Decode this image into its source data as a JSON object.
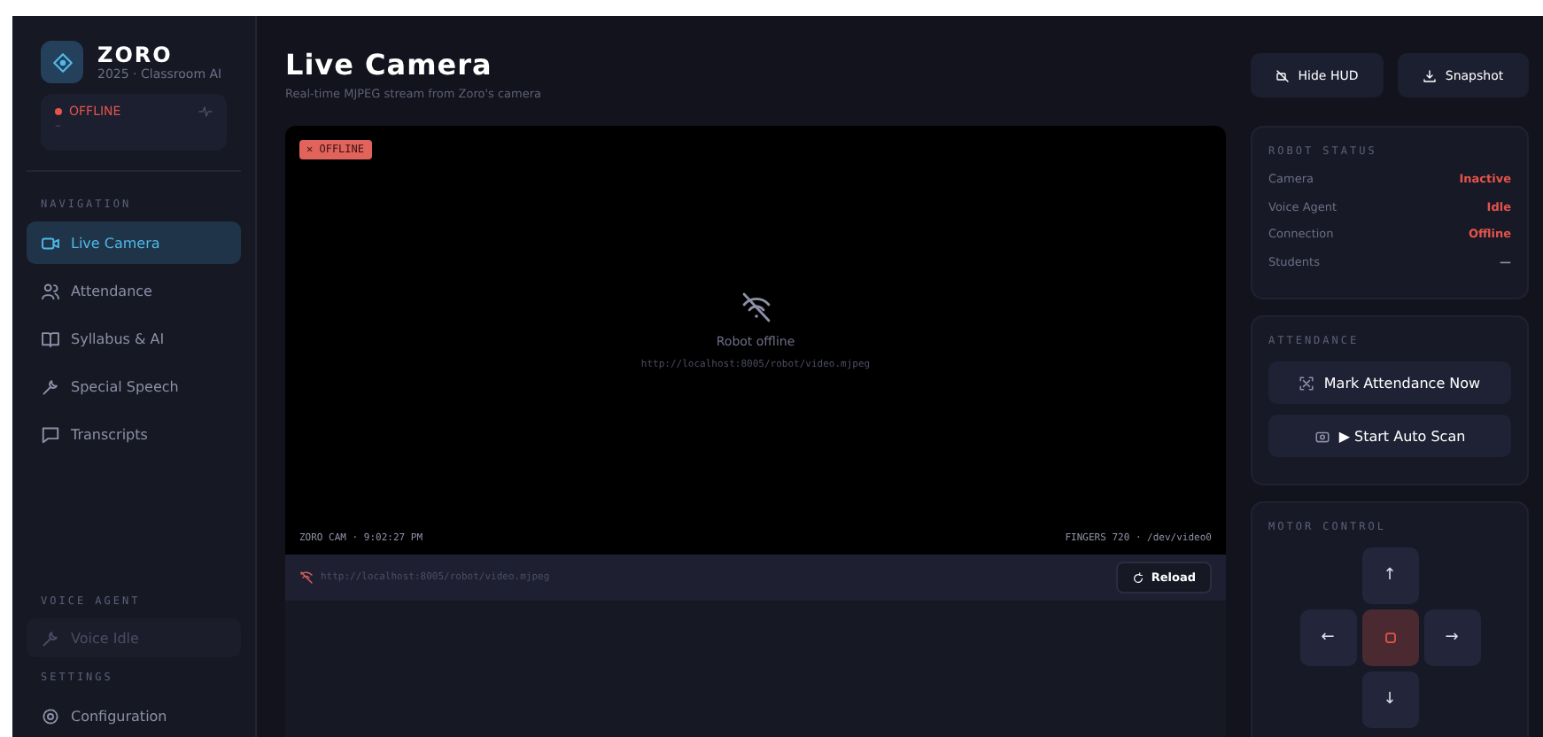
{
  "brand": {
    "name": "ZORO",
    "subtitle": "2025 · Classroom AI"
  },
  "connection": {
    "label": "OFFLINE",
    "detail": "–",
    "online": false
  },
  "sidebar": {
    "nav_heading": "NAVIGATION",
    "items": [
      {
        "label": "Live Camera",
        "selected": true
      },
      {
        "label": "Attendance",
        "selected": false
      },
      {
        "label": "Syllabus & AI",
        "selected": false
      },
      {
        "label": "Special Speech",
        "selected": false
      },
      {
        "label": "Transcripts",
        "selected": false
      }
    ],
    "voice_heading": "VOICE AGENT",
    "voice_status": "Voice Idle",
    "voice_active": false,
    "settings_heading": "SETTINGS",
    "settings_item": "Configuration"
  },
  "header": {
    "title": "Live Camera",
    "subtitle": "Real-time MJPEG stream from Zoro's camera"
  },
  "toolbar": {
    "buttons": [
      "Hide HUD",
      "Snapshot"
    ]
  },
  "camera": {
    "badge": "✕ OFFLINE",
    "online": false,
    "message": "Robot offline",
    "stream_url": "http://localhost:8005/robot/video.mjpeg",
    "hud_left": "ZORO CAM · 9:02:27 PM",
    "hud_right": "FINGERS 720 · /dev/video0",
    "url_bar": "http://localhost:8005/robot/video.mjpeg",
    "reload": "Reload"
  },
  "robot_status": {
    "heading": "ROBOT STATUS",
    "rows": [
      {
        "label": "Camera",
        "value": "Inactive",
        "color": "#e5534b"
      },
      {
        "label": "Voice Agent",
        "value": "Idle",
        "color": "#e5534b"
      },
      {
        "label": "Connection",
        "value": "Offline",
        "color": "#e5534b"
      },
      {
        "label": "Students",
        "value": "—",
        "color": "#8d90a6"
      }
    ]
  },
  "attendance": {
    "heading": "ATTENDANCE",
    "buttons": [
      "Mark Attendance Now",
      "▶ Start Auto Scan"
    ]
  },
  "motor": {
    "heading": "MOTOR CONTROL",
    "up": "↑",
    "left": "←",
    "right": "→",
    "down": "↓"
  }
}
